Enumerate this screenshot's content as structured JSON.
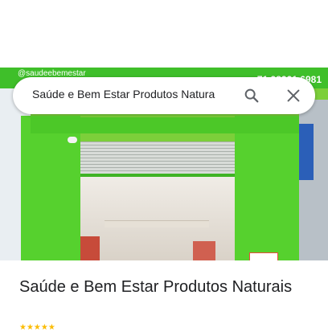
{
  "search": {
    "value": "Saúde e Bem Estar Produtos Natura"
  },
  "photo": {
    "instagram_handle": "@saudeebemestar",
    "phone_fragment": "71 98221 6981"
  },
  "place": {
    "title": "Saúde e Bem Estar Produtos Naturais"
  },
  "icons": {
    "search": "search-icon",
    "close": "close-icon"
  }
}
